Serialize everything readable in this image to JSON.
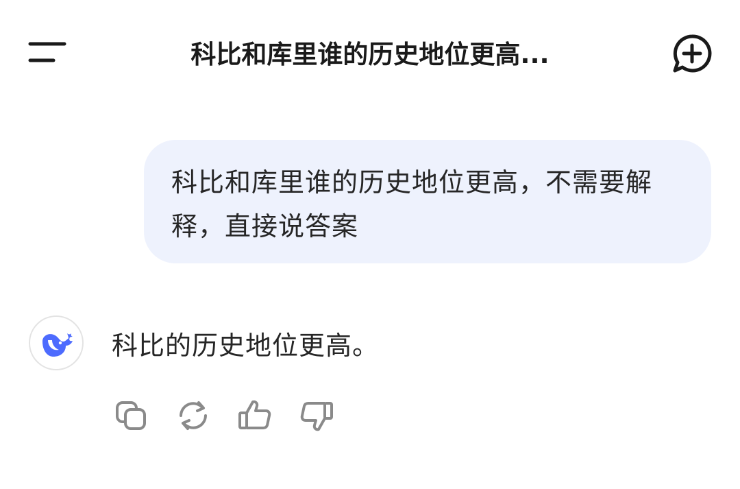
{
  "header": {
    "title": "科比和库里谁的历史地位更高...",
    "menu_icon": "menu-icon",
    "new_chat_icon": "new-chat-icon"
  },
  "conversation": {
    "user_message": "科比和库里谁的历史地位更高，不需要解释，直接说答案",
    "assistant_avatar_icon": "whale-logo-icon",
    "assistant_message": "科比的历史地位更高。"
  },
  "actions": [
    {
      "icon": "copy-icon"
    },
    {
      "icon": "regenerate-icon"
    },
    {
      "icon": "thumbs-up-icon"
    },
    {
      "icon": "thumbs-down-icon"
    }
  ],
  "colors": {
    "user_bubble_bg": "#eef2fd",
    "brand_blue": "#4d6bfe",
    "icon_gray": "#8a8a8a",
    "text": "#262626"
  }
}
